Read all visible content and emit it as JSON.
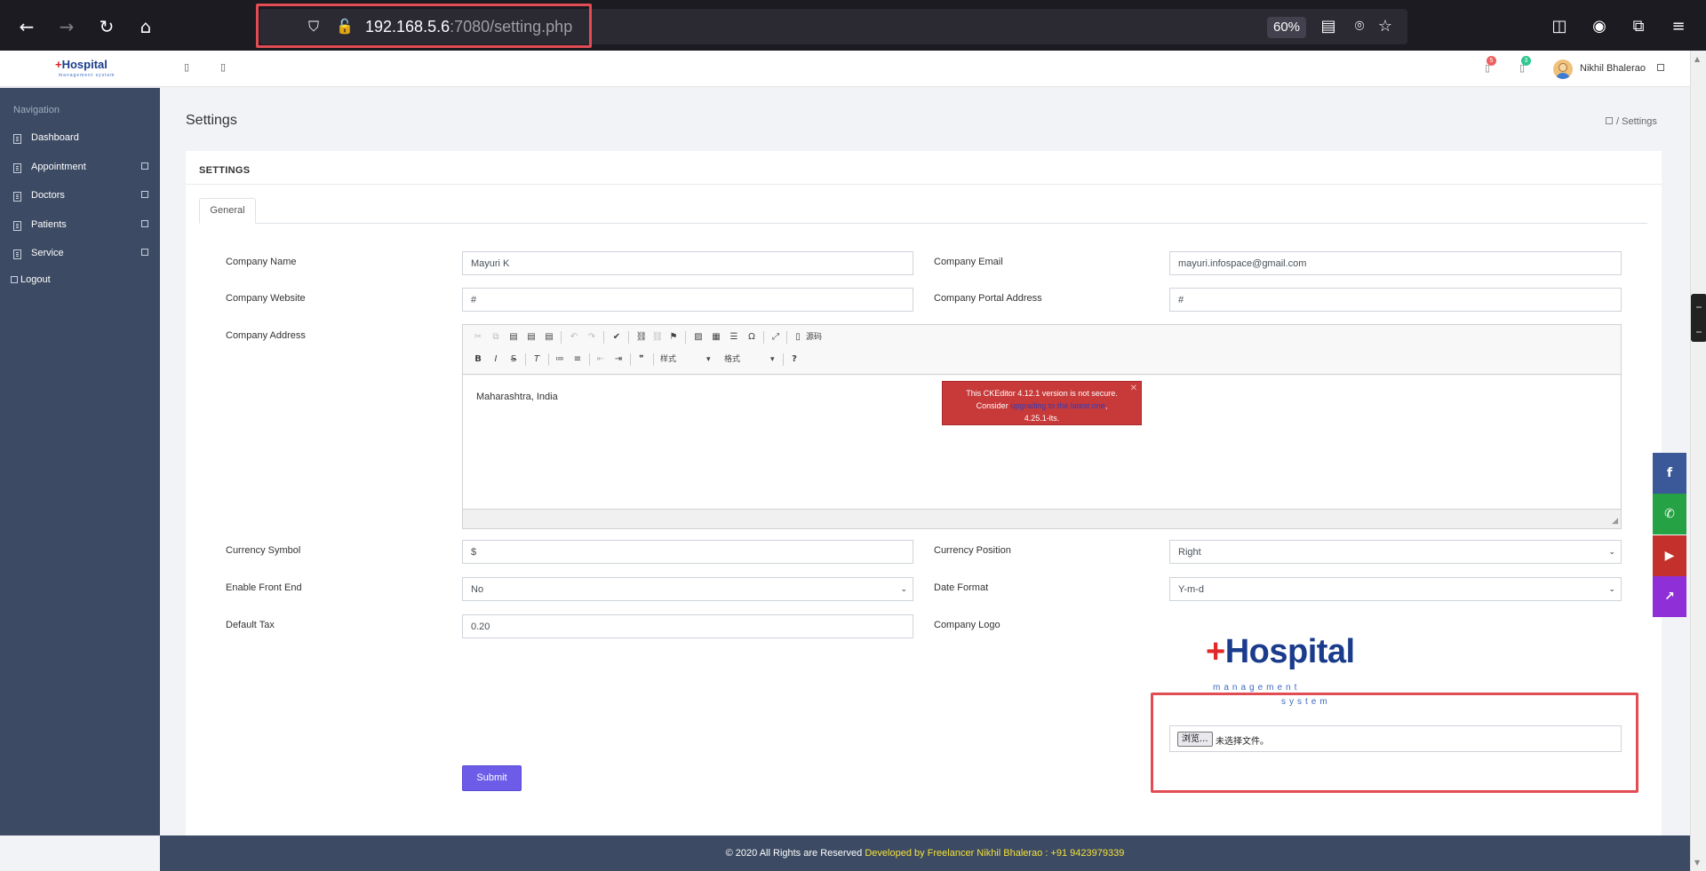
{
  "browser": {
    "url_host": "192.168.5.6",
    "url_rest": ":7080/setting.php",
    "zoom": "60%"
  },
  "header": {
    "logo_title": "Hospital",
    "logo_cross": "+",
    "logo_subtitle": "management system",
    "user_name": "Nikhil Bhalerao",
    "notifications": [
      {
        "count": "5",
        "color": "#ef5f5f"
      },
      {
        "count": "3",
        "color": "#2ec88f"
      }
    ]
  },
  "sidebar": {
    "title": "Navigation",
    "items": [
      {
        "label": "Dashboard",
        "has_submenu": false
      },
      {
        "label": "Appointment",
        "has_submenu": true
      },
      {
        "label": "Doctors",
        "has_submenu": true
      },
      {
        "label": "Patients",
        "has_submenu": true
      },
      {
        "label": "Service",
        "has_submenu": true
      }
    ],
    "logout_label": "Logout"
  },
  "page": {
    "title": "Settings",
    "breadcrumb": "Settings",
    "card_title": "SETTINGS",
    "tab_label": "General"
  },
  "form": {
    "company_name_label": "Company Name",
    "company_name_value": "Mayuri K",
    "company_email_label": "Company Email",
    "company_email_value": "mayuri.infospace@gmail.com",
    "company_website_label": "Company Website",
    "company_website_value": "#",
    "company_portal_label": "Company Portal Address",
    "company_portal_value": "#",
    "company_address_label": "Company Address",
    "company_address_value": "Maharashtra, India",
    "currency_symbol_label": "Currency Symbol",
    "currency_symbol_value": "$",
    "currency_position_label": "Currency Position",
    "currency_position_value": "Right",
    "enable_front_end_label": "Enable Front End",
    "enable_front_end_value": "No",
    "date_format_label": "Date Format",
    "date_format_value": "Y-m-d",
    "default_tax_label": "Default Tax",
    "default_tax_value": "0.20",
    "company_logo_label": "Company Logo",
    "file_button_label": "浏览...",
    "file_status": "未选择文件。",
    "submit_label": "Submit"
  },
  "editor": {
    "styles_combo": "样式",
    "format_combo": "格式",
    "source_label": "源码",
    "warning_line1": "This CKEditor 4.12.1 version is not secure.",
    "warning_prefix": "Consider",
    "warning_link": "upgrading to the latest one",
    "warning_line3": "4.25.1-lts."
  },
  "company_logo": {
    "title": "Hospital",
    "subtitle1": "management",
    "subtitle2": "system"
  },
  "footer": {
    "copyright": "© 2020 All Rights are Reserved",
    "developer": "Developed by Freelancer Nikhil Bhalerao : +91 9423979339"
  },
  "social": [
    {
      "icon": "facebook-icon",
      "glyph": "f",
      "color": "#3b5998"
    },
    {
      "icon": "whatsapp-icon",
      "glyph": "✆",
      "color": "#25a244"
    },
    {
      "icon": "youtube-icon",
      "glyph": "▶",
      "color": "#c4302b"
    },
    {
      "icon": "external-link-icon",
      "glyph": "↗",
      "color": "#8f2fd7"
    }
  ]
}
